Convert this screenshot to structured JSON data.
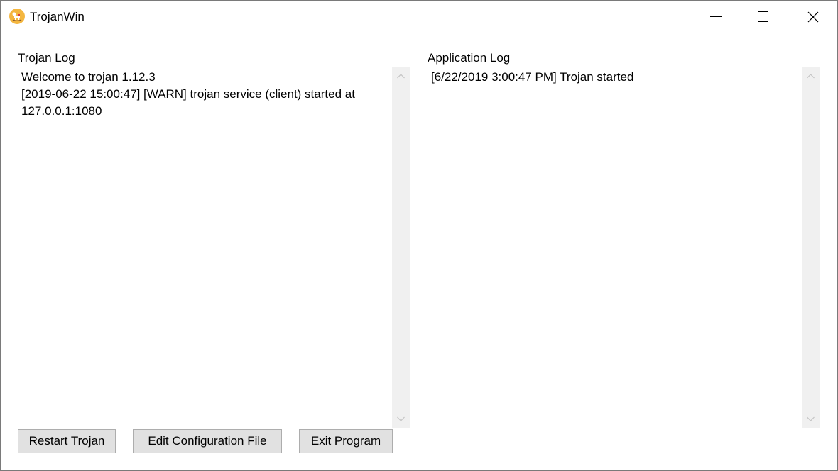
{
  "window": {
    "title": "TrojanWin",
    "icon": "rocking-horse-icon",
    "controls": [
      "minimize-icon",
      "maximize-icon",
      "close-icon"
    ]
  },
  "trojan_log": {
    "label": "Trojan Log",
    "text": "Welcome to trojan 1.12.3\n[2019-06-22 15:00:47] [WARN] trojan service (client) started at 127.0.0.1:1080"
  },
  "application_log": {
    "label": "Application Log",
    "text": "[6/22/2019 3:00:47 PM] Trojan started"
  },
  "buttons": {
    "restart": "Restart Trojan",
    "edit_config": "Edit Configuration File",
    "exit": "Exit Program"
  }
}
